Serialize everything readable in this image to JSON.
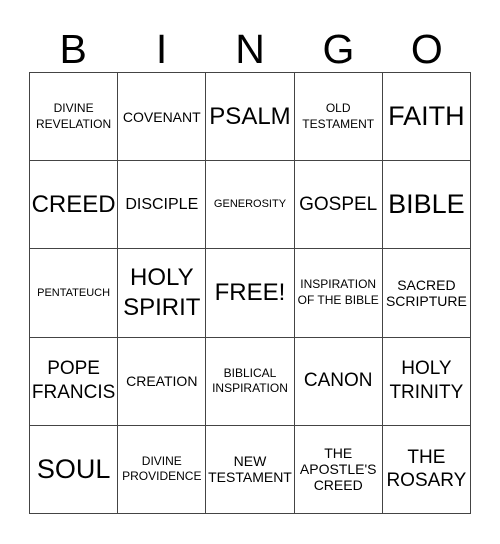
{
  "header": {
    "letters": [
      "B",
      "I",
      "N",
      "G",
      "O"
    ]
  },
  "grid": {
    "rows": [
      [
        "DIVINE REVELATION",
        "COVENANT",
        "PSALM",
        "OLD TESTAMENT",
        "FAITH"
      ],
      [
        "CREED",
        "DISCIPLE",
        "GENEROSITY",
        "GOSPEL",
        "BIBLE"
      ],
      [
        "PENTATEUCH",
        "HOLY SPIRIT",
        "FREE!",
        "INSPIRATION OF THE BIBLE",
        "SACRED SCRIPTURE"
      ],
      [
        "POPE FRANCIS",
        "CREATION",
        "BIBLICAL INSPIRATION",
        "CANON",
        "HOLY TRINITY"
      ],
      [
        "SOUL",
        "DIVINE PROVIDENCE",
        "NEW TESTAMENT",
        "THE APOSTLE'S CREED",
        "THE ROSARY"
      ]
    ]
  }
}
